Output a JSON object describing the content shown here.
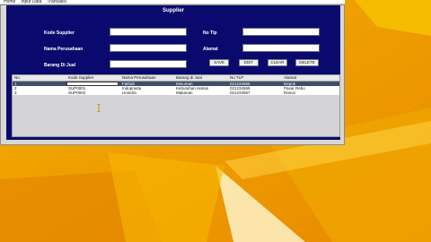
{
  "menubar": {
    "items": [
      "Home",
      "Input Data",
      "Transaksi"
    ]
  },
  "form": {
    "title": "Supplier",
    "labels": {
      "kode_supplier": "Kode Supplier",
      "nama_perusahaan": "Nama Perusahaan",
      "barang_di_jual": "Barang Di Jual",
      "no_tlp": "No Tlp",
      "alamat": "Alamat"
    },
    "values": {
      "kode_supplier": "",
      "nama_perusahaan": "",
      "barang_di_jual": "",
      "no_tlp": "",
      "alamat": ""
    },
    "buttons": {
      "save": "SAVE",
      "edit": "EDIT",
      "clear": "CLEAR",
      "delete": "DELETE"
    }
  },
  "table": {
    "columns": [
      "No",
      "Kode Supplier",
      "Nama Perusahaan",
      "Barang di Jual",
      "No TLP",
      "Alamat"
    ],
    "rows": [
      [
        "1",
        "",
        "Fathah",
        "Minuman",
        "021234565",
        "Depok"
      ],
      [
        "2",
        "SUP0001",
        "Indoprasta",
        "Kebutuhan Harian",
        "021234565",
        "Pasar Rebo"
      ],
      [
        "3",
        "SUP0002",
        "Unindra",
        "Makanan",
        "021234567",
        "Ramoi"
      ]
    ]
  },
  "colors": {
    "panel": "#0a0a6e",
    "selected_row": "#3e4f6a",
    "desktop": "#f2a400"
  }
}
